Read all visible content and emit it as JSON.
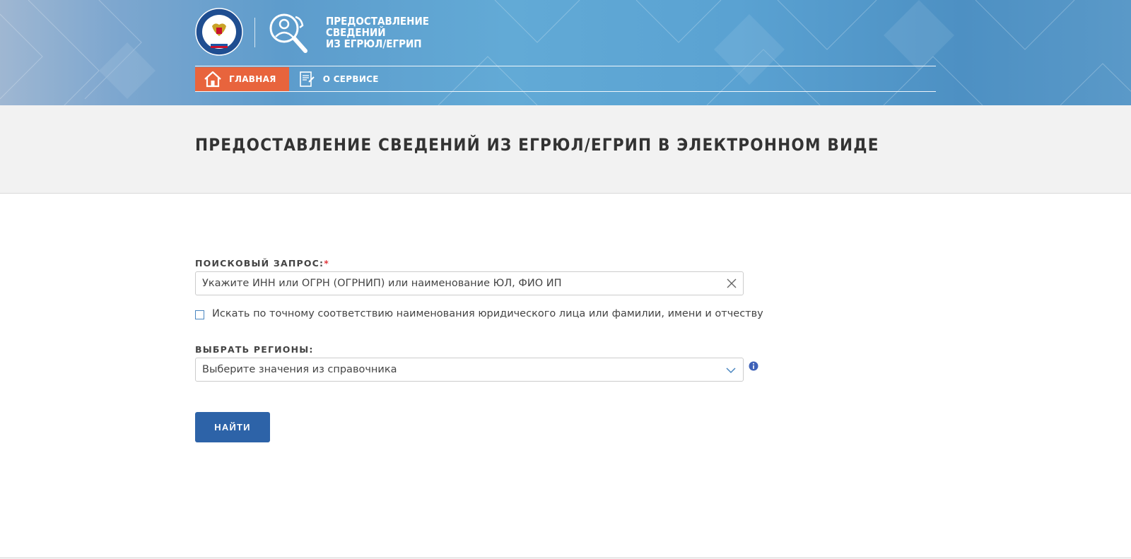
{
  "brand": {
    "line1": "ПРЕДОСТАВЛЕНИЕ",
    "line2": "СВЕДЕНИЙ",
    "line3": "ИЗ ЕГРЮЛ/ЕГРИП"
  },
  "nav": {
    "items": [
      {
        "label": "ГЛАВНАЯ",
        "icon": "home-icon",
        "active": true
      },
      {
        "label": "О СЕРВИСЕ",
        "icon": "document-icon",
        "active": false
      }
    ]
  },
  "page": {
    "title": "ПРЕДОСТАВЛЕНИЕ СВЕДЕНИЙ ИЗ ЕГРЮЛ/ЕГРИП В ЭЛЕКТРОННОМ ВИДЕ"
  },
  "form": {
    "query_label": "ПОИСКОВЫЙ ЗАПРОС:",
    "required_mark": "*",
    "query_placeholder": "Укажите ИНН или ОГРН (ОГРНИП) или наименование ЮЛ, ФИО ИП",
    "exact_match_label": "Искать по точному соответствию наименования юридического лица или фамилии, имени и отчеству",
    "exact_match_checked": false,
    "regions_label": "ВЫБРАТЬ РЕГИОНЫ:",
    "regions_placeholder": "Выберите значения из справочника",
    "submit_label": "НАЙТИ"
  },
  "colors": {
    "active_nav": "#e8643d",
    "primary_button": "#2d63a8",
    "required": "#e0393e",
    "info": "#3f62b8"
  }
}
